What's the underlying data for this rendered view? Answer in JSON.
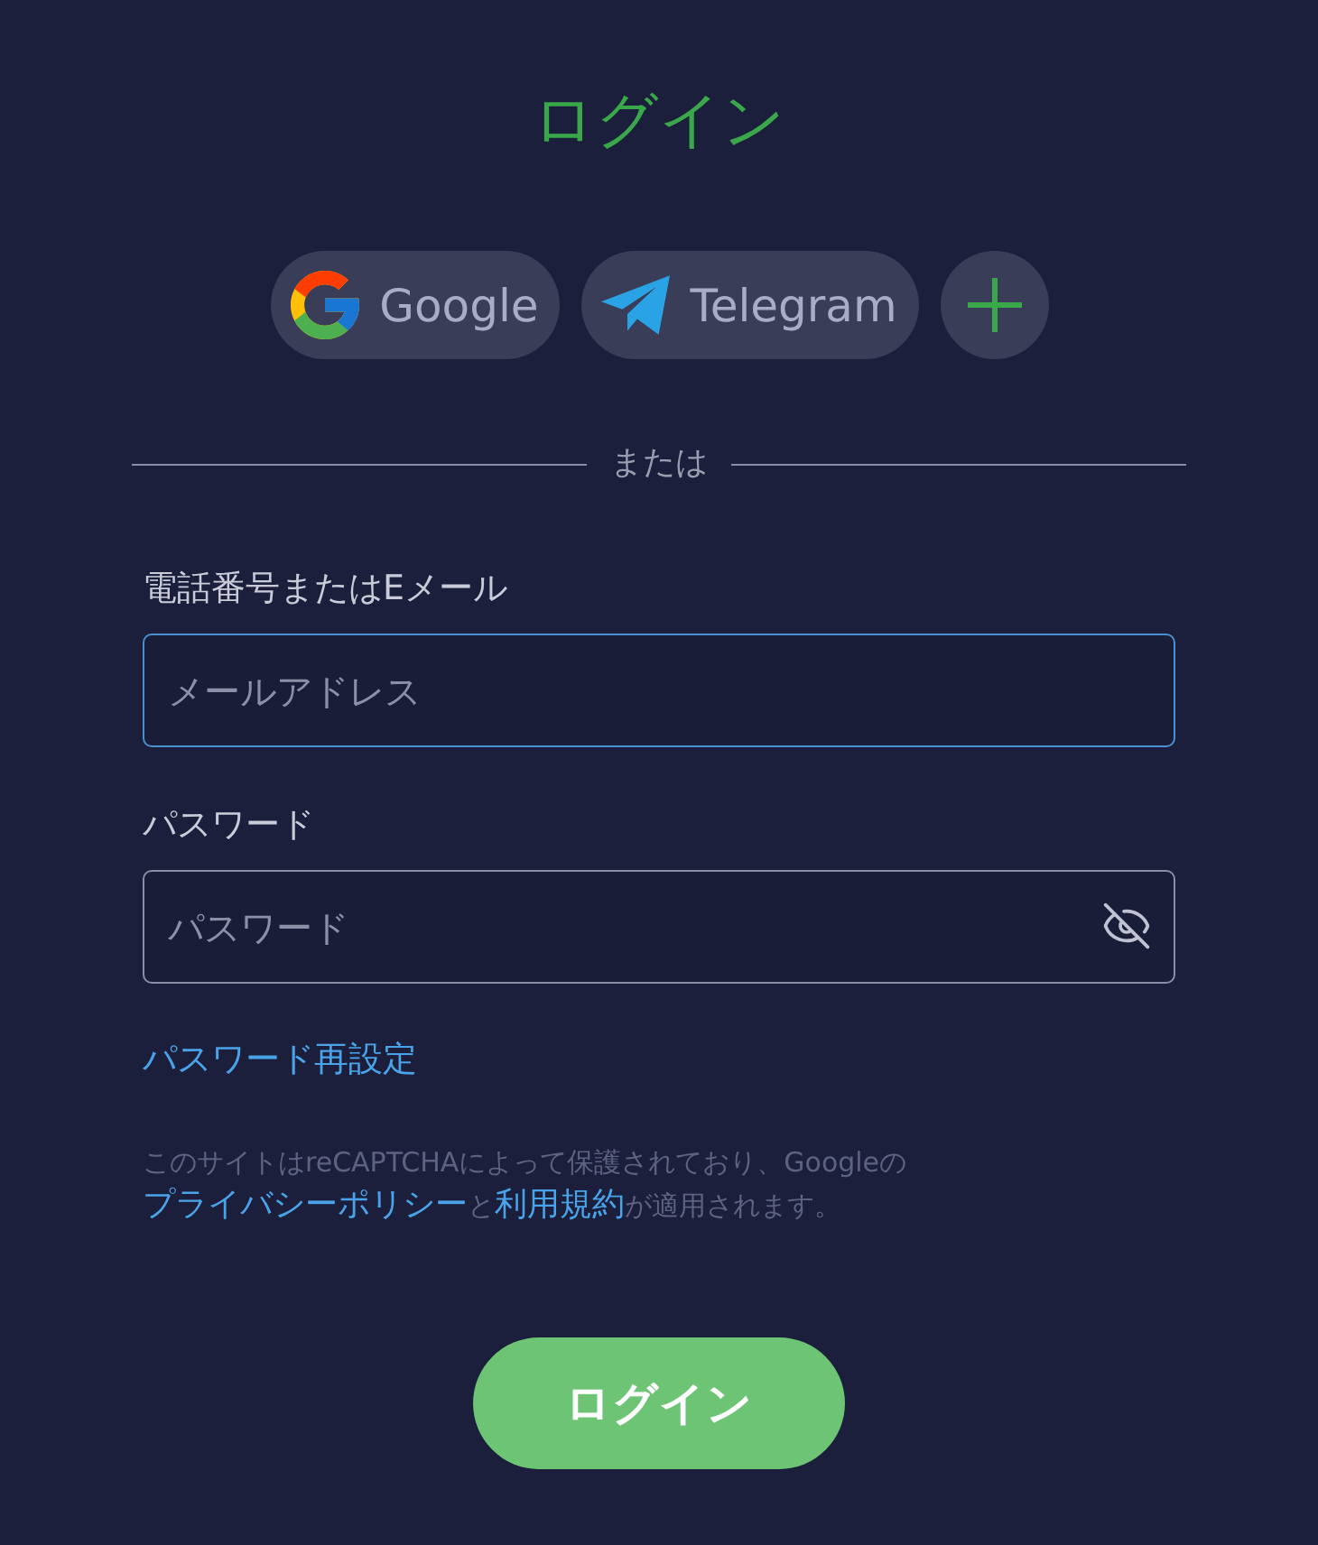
{
  "title": "ログイン",
  "social_buttons": [
    {
      "kind": "google",
      "label": "Google"
    },
    {
      "kind": "telegram",
      "label": "Telegram"
    },
    {
      "kind": "more"
    }
  ],
  "divider": {
    "text": "または"
  },
  "fields": [
    {
      "kind": "text",
      "label": "電話番号またはEメール",
      "placeholder": "メールアドレス",
      "focused": true
    },
    {
      "kind": "password",
      "label": "パスワード",
      "placeholder": "パスワード",
      "focused": false
    }
  ],
  "reset_link": "パスワード再設定",
  "notice": [
    {
      "kind": "text",
      "text": "このサイトはreCAPTCHAによって保護されており、Googleの"
    },
    {
      "kind": "link",
      "text": "プライバシーポリシー"
    },
    {
      "kind": "text",
      "text": "と"
    },
    {
      "kind": "link",
      "text": "利用規約"
    },
    {
      "kind": "text",
      "text": "が適用されます。"
    }
  ],
  "submit_button": "ログイン"
}
